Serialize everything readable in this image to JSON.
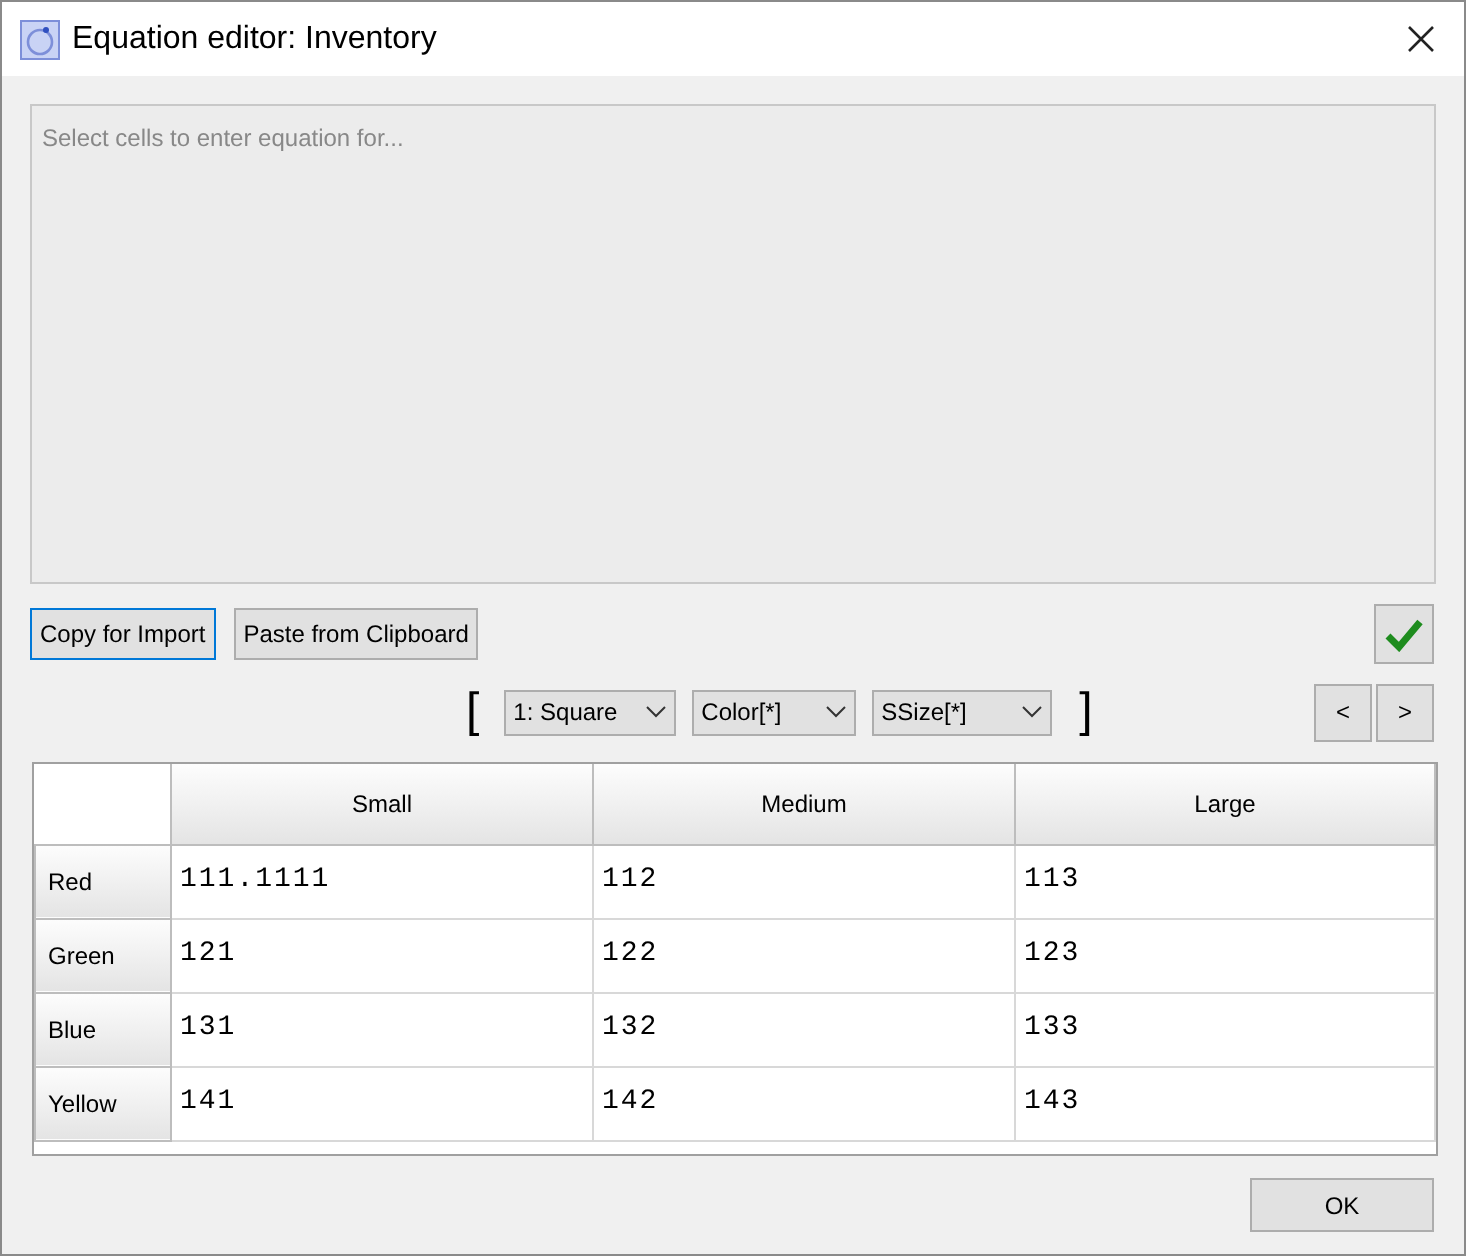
{
  "window": {
    "title": "Equation editor: Inventory"
  },
  "equation": {
    "placeholder": "Select cells to enter equation for..."
  },
  "buttons": [
    {
      "label": "Copy for Import",
      "focused": true
    },
    {
      "label": "Paste from Clipboard",
      "focused": false
    }
  ],
  "bracket_open": "[",
  "bracket_close": "]",
  "dropdowns": [
    "1: Square",
    "Color[*]",
    "SSize[*]"
  ],
  "nav": [
    "<",
    ">"
  ],
  "table": {
    "columns": [
      "Small",
      "Medium",
      "Large"
    ],
    "rows": [
      {
        "header": "Red",
        "cells": [
          "111.1111",
          "112",
          "113"
        ]
      },
      {
        "header": "Green",
        "cells": [
          "121",
          "122",
          "123"
        ]
      },
      {
        "header": "Blue",
        "cells": [
          "131",
          "132",
          "133"
        ]
      },
      {
        "header": "Yellow",
        "cells": [
          "141",
          "142",
          "143"
        ]
      }
    ]
  },
  "ok": "OK"
}
